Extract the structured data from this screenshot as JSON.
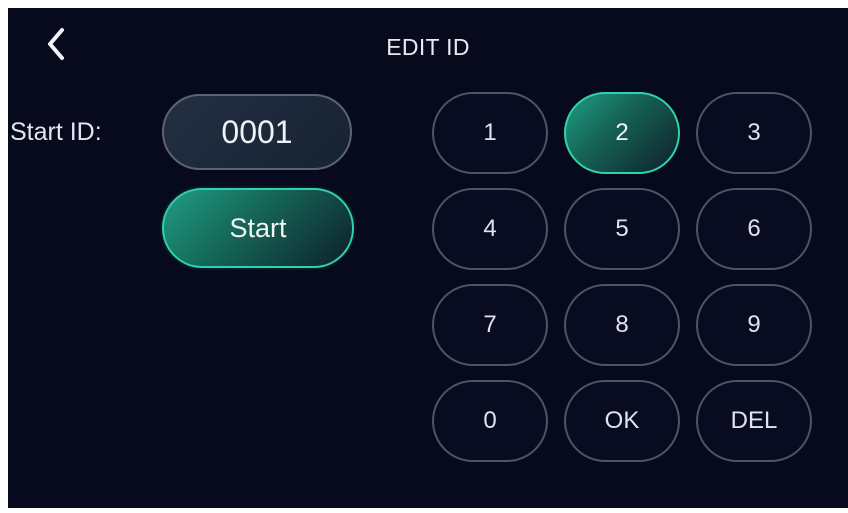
{
  "header": {
    "title": "EDIT ID",
    "back_icon": "chevron-left-icon"
  },
  "form": {
    "start_id_label": "Start ID:",
    "start_id_value": "0001",
    "start_button_label": "Start"
  },
  "keypad": {
    "selected_key": "2",
    "keys": [
      "1",
      "2",
      "3",
      "4",
      "5",
      "6",
      "7",
      "8",
      "9",
      "0",
      "OK",
      "DEL"
    ]
  },
  "colors": {
    "background": "#07091c",
    "accent": "#2ed3a9",
    "key_border": "#4b5567",
    "text": "#e3e6ee"
  }
}
